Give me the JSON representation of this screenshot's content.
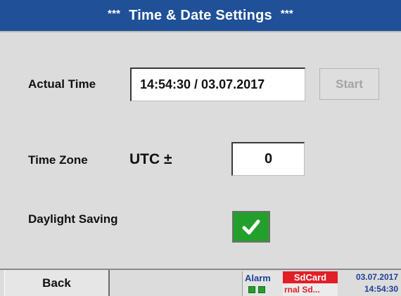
{
  "title": {
    "stars_left": "***",
    "text": "Time & Date Settings",
    "stars_right": "***"
  },
  "actual_time": {
    "label": "Actual Time",
    "value": "14:54:30 / 03.07.2017",
    "start_label": "Start"
  },
  "time_zone": {
    "label": "Time Zone",
    "utc_label": "UTC ±",
    "value": "0"
  },
  "daylight_saving": {
    "label": "Daylight Saving",
    "checked": true,
    "check_glyph": "✔"
  },
  "footer": {
    "back_label": "Back",
    "alarm_label": "Alarm",
    "sd_title": "SdCard",
    "sd_sub": "rnal Sd...",
    "date": "03.07.2017",
    "time": "14:54:30"
  },
  "colors": {
    "title_bg": "#1f5098",
    "checkbox_bg": "#23a02b",
    "sd_red": "#e21e26",
    "status_blue": "#1f3f99"
  },
  "icons": {
    "checkbox": "check-icon",
    "leds": "status-led-icon"
  }
}
